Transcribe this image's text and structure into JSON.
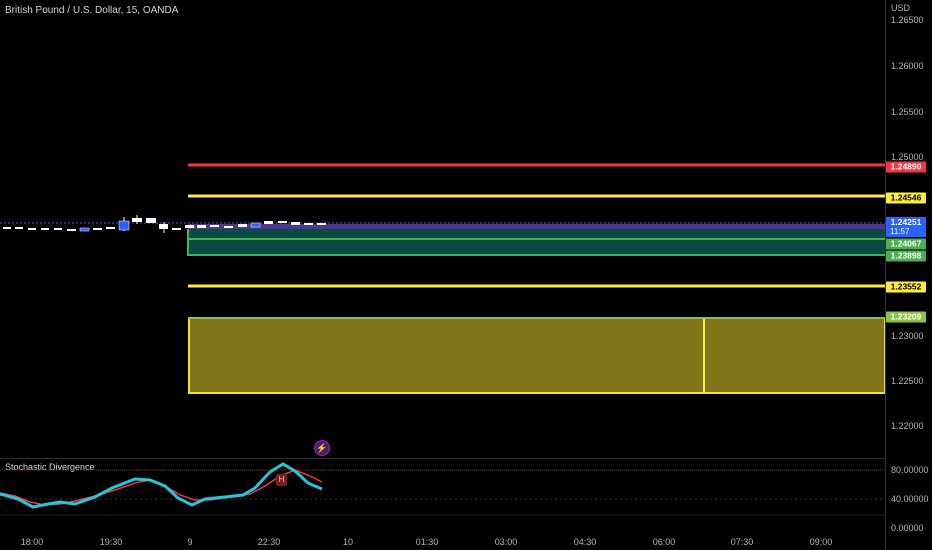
{
  "header": {
    "symbol_title": "British Pound / U.S. Dollar, 15, OANDA"
  },
  "price_axis": {
    "currency": "USD",
    "ticks": [
      "1.26500",
      "1.26000",
      "1.25500",
      "1.25000",
      "1.23000",
      "1.22500",
      "1.22000"
    ]
  },
  "levels": {
    "red": {
      "value": "1.24890",
      "color": "#f23645"
    },
    "yellow_top": {
      "value": "1.24546",
      "color": "#ffeb3b"
    },
    "current_price": {
      "value": "1.24251",
      "countdown": "11:57",
      "color": "#2962ff"
    },
    "green_upper": {
      "value": "1.24067",
      "color": "#4caf50"
    },
    "green_lower": {
      "value": "1.23898",
      "color": "#4caf50"
    },
    "yellow_mid": {
      "value": "1.23552",
      "color": "#ffeb3b"
    },
    "zone_top": {
      "value": "1.23209",
      "color": "#8bc34a"
    }
  },
  "time_axis": {
    "ticks": [
      "18:00",
      "19:30",
      "9",
      "22:30",
      "10",
      "01:30",
      "03:00",
      "04:30",
      "06:00",
      "07:30",
      "09:00"
    ]
  },
  "oscillator": {
    "name": "Stochastic Divergence",
    "ticks": [
      "80.00000",
      "40.00000",
      "0.00000"
    ],
    "divergence_badge": "H",
    "k_color": "#26c6da",
    "d_color": "#f23645"
  },
  "icons": {
    "alert": "lightning-icon"
  }
}
